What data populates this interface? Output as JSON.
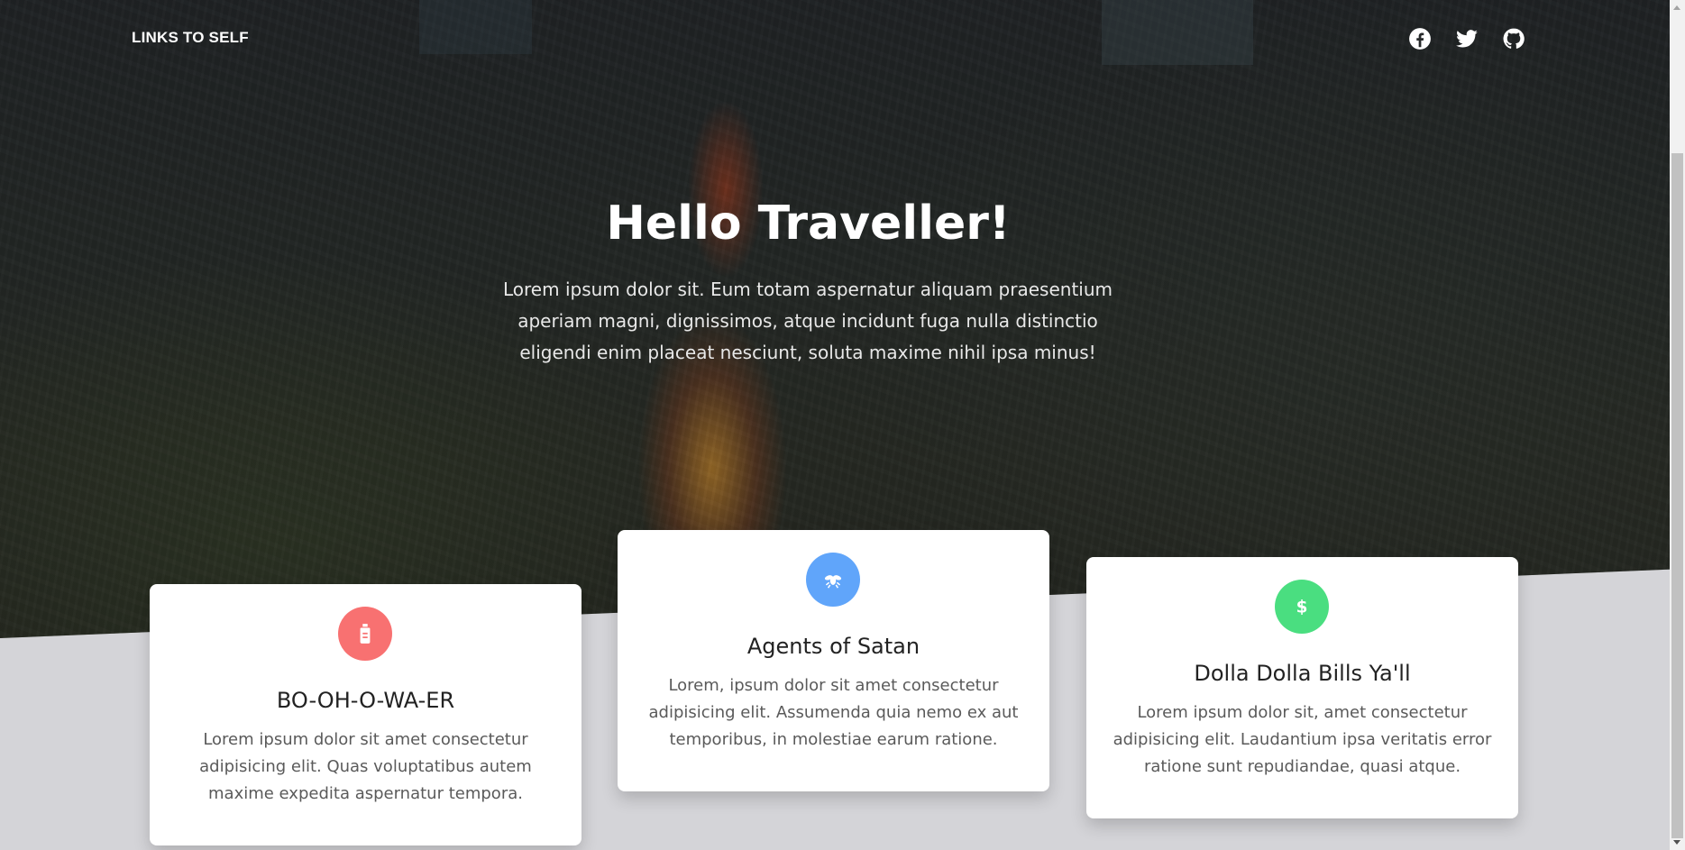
{
  "nav": {
    "brand": "LINKS TO SELF",
    "social": [
      {
        "icon": "facebook-icon"
      },
      {
        "icon": "twitter-icon"
      },
      {
        "icon": "github-icon"
      }
    ]
  },
  "hero": {
    "title": "Hello Traveller!",
    "text": "Lorem ipsum dolor sit. Eum totam aspernatur aliquam praesentium aperiam magni, dignissimos, atque incidunt fuga nulla distinctio eligendi enim placeat nesciunt, soluta maxime nihil ipsa minus!"
  },
  "cards": [
    {
      "icon": "bottle-icon",
      "icon_color": "#f87171",
      "title": "BO-OH-O-WA-ER",
      "text": "Lorem ipsum dolor sit amet consectetur adipisicing elit. Quas voluptatibus autem maxime expedita aspernatur tempora."
    },
    {
      "icon": "bug-icon",
      "icon_color": "#60a5fa",
      "title": "Agents of Satan",
      "text": "Lorem, ipsum dolor sit amet consectetur adipisicing elit. Assumenda quia nemo ex aut temporibus, in molestiae earum ratione."
    },
    {
      "icon": "dollar-icon",
      "icon_color": "#4ade80",
      "title": "Dolla Dolla Bills Ya'll",
      "text": "Lorem ipsum dolor sit, amet consectetur adipisicing elit. Laudantium ipsa veritatis error ratione sunt repudiandae, quasi atque."
    }
  ],
  "colors": {
    "background": "#d4d4d8",
    "card": "#ffffff"
  }
}
